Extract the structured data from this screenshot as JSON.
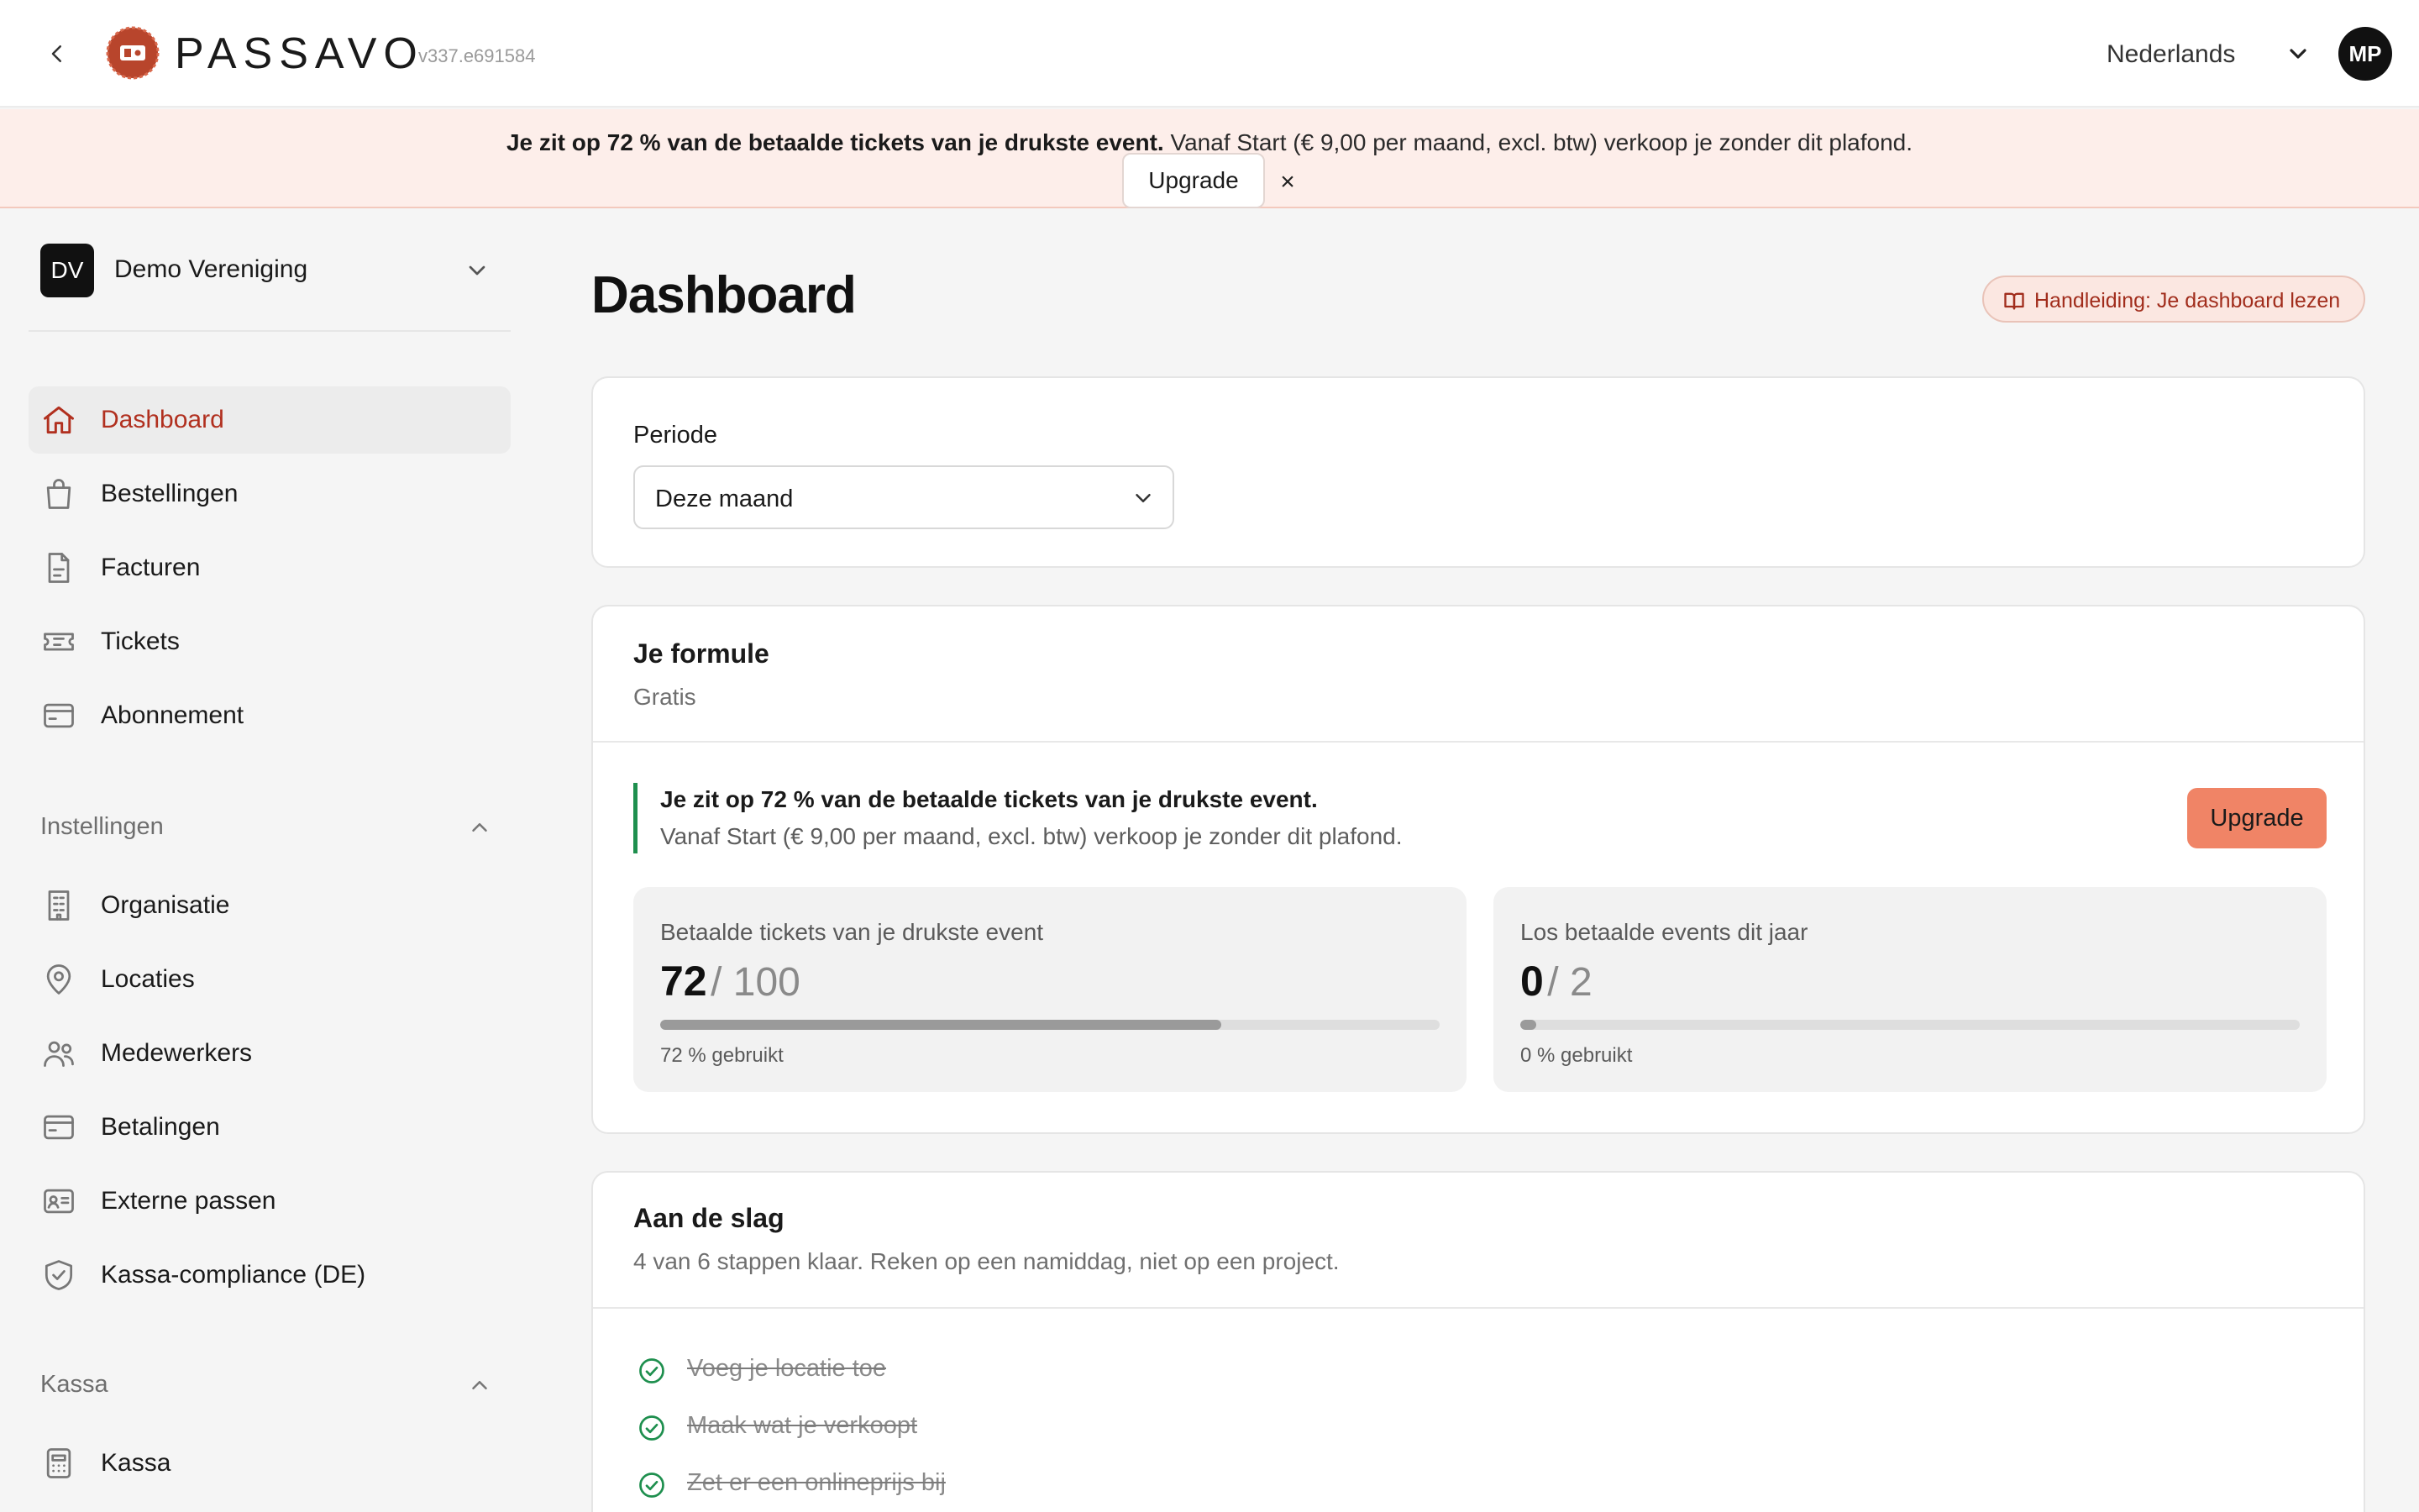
{
  "header": {
    "brand": "PASSAVO",
    "version": "v337.e691584",
    "language": "Nederlands",
    "avatar_initials": "MP",
    "icons": {
      "back": "chevron-left-icon",
      "logo": "passavo-logo",
      "language": "chevron-down-icon"
    }
  },
  "banner": {
    "bold_text": "Je zit op 72 % van de betaalde tickets van je drukste event.",
    "text": " Vanaf Start (€ 9,00 per maand, excl. btw) verkoop je zonder dit plafond.",
    "upgrade_label": "Upgrade",
    "close_label": "×",
    "colors": {
      "background": "#fdeeea",
      "border": "#f3c9bd"
    }
  },
  "sidebar": {
    "org": {
      "initials": "DV",
      "name": "Demo Vereniging"
    },
    "items": [
      {
        "label": "Dashboard",
        "icon": "home-icon",
        "active": true
      },
      {
        "label": "Bestellingen",
        "icon": "shopping-bag-icon"
      },
      {
        "label": "Facturen",
        "icon": "document-icon"
      },
      {
        "label": "Tickets",
        "icon": "ticket-icon"
      },
      {
        "label": "Abonnement",
        "icon": "credit-card-icon"
      }
    ],
    "settings": {
      "title": "Instellingen",
      "items": [
        {
          "label": "Organisatie",
          "icon": "building-icon"
        },
        {
          "label": "Locaties",
          "icon": "map-pin-icon"
        },
        {
          "label": "Medewerkers",
          "icon": "users-icon"
        },
        {
          "label": "Betalingen",
          "icon": "credit-card-icon"
        },
        {
          "label": "Externe passen",
          "icon": "id-card-icon"
        },
        {
          "label": "Kassa-compliance (DE)",
          "icon": "shield-check-icon"
        }
      ]
    },
    "kassa": {
      "title": "Kassa",
      "items": [
        {
          "label": "Kassa",
          "icon": "calculator-icon"
        }
      ]
    }
  },
  "main": {
    "title": "Dashboard",
    "guide_label": "Handleiding: Je dashboard lezen",
    "period": {
      "label": "Periode",
      "value": "Deze maand"
    },
    "plan": {
      "title": "Je formule",
      "name": "Gratis",
      "notice_title": "Je zit op 72 % van de betaalde tickets van je drukste event.",
      "notice_text": "Vanaf Start (€ 9,00 per maand, excl. btw) verkoop je zonder dit plafond.",
      "upgrade_label": "Upgrade",
      "meters": [
        {
          "label": "Betaalde tickets van je drukste event",
          "value": "72",
          "max": "/ 100",
          "used_fraction": 0.72,
          "foot": "72 % gebruikt"
        },
        {
          "label": "Los betaalde events dit jaar",
          "value": "0",
          "max": "/ 2",
          "used_fraction": 0.0,
          "foot": "0 % gebruikt"
        }
      ]
    },
    "getting_started": {
      "title": "Aan de slag",
      "subtitle": "4 van 6 stappen klaar. Reken op een namiddag, niet op een project.",
      "steps": [
        {
          "label": "Voeg je locatie toe",
          "done": true
        },
        {
          "label": "Maak wat je verkoopt",
          "done": true
        },
        {
          "label": "Zet er een onlineprijs bij",
          "done": true
        }
      ]
    }
  },
  "colors": {
    "accent": "#b1301f",
    "upgrade_button": "#f08466",
    "success": "#1e8f4e",
    "page_bg": "#f5f5f5"
  }
}
